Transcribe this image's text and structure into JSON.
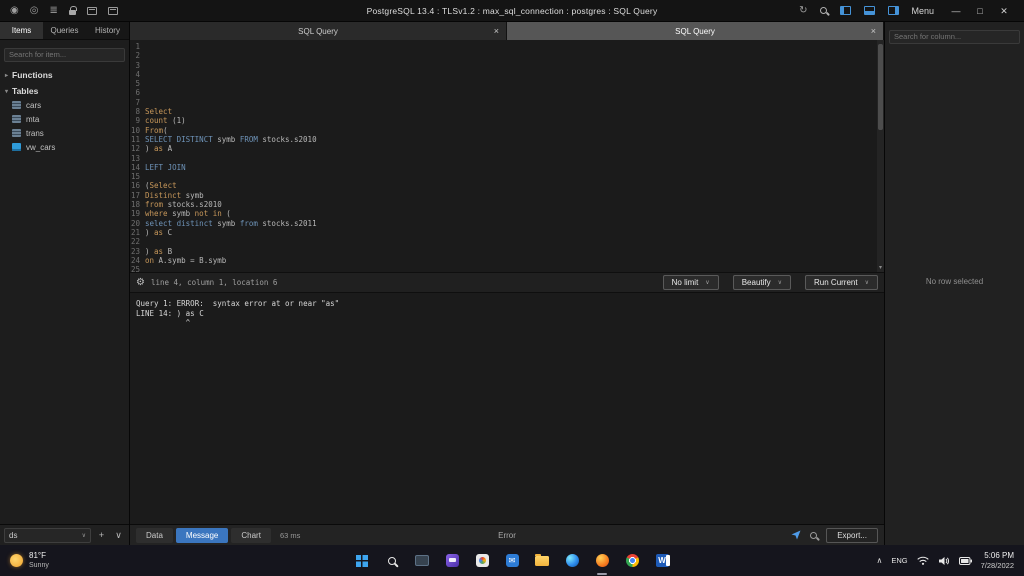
{
  "titlebar": {
    "title": "PostgreSQL 13.4 : TLSv1.2 : max_sql_connection : postgres : SQL Query",
    "menu_label": "Menu",
    "left_icons": [
      {
        "name": "app-logo-icon",
        "shape": "glyph",
        "glyph": "◉"
      },
      {
        "name": "eye-icon",
        "shape": "glyph",
        "glyph": "◎"
      },
      {
        "name": "list-icon",
        "shape": "glyph",
        "glyph": "≣"
      },
      {
        "name": "lock-icon",
        "shape": "lock",
        "glyph": ""
      },
      {
        "name": "console-icon",
        "shape": "panel",
        "glyph": ""
      },
      {
        "name": "editor-view-icon",
        "shape": "panel",
        "glyph": ""
      }
    ],
    "right_icons": [
      {
        "name": "refresh-icon",
        "shape": "glyph",
        "glyph": "↻"
      },
      {
        "name": "search-icon",
        "shape": "mag",
        "glyph": ""
      },
      {
        "name": "layout-left-icon",
        "shape": "layoutl",
        "glyph": ""
      },
      {
        "name": "layout-bottom-icon",
        "shape": "layoutb",
        "glyph": ""
      },
      {
        "name": "layout-right-icon",
        "shape": "layoutr",
        "glyph": ""
      }
    ],
    "window_controls": [
      {
        "name": "minimize-button",
        "glyph": "—"
      },
      {
        "name": "maximize-button",
        "glyph": "□"
      },
      {
        "name": "close-button",
        "glyph": "✕"
      }
    ]
  },
  "sidebar": {
    "tabs": [
      {
        "label": "Items",
        "active": true
      },
      {
        "label": "Queries",
        "active": false
      },
      {
        "label": "History",
        "active": false
      }
    ],
    "search_placeholder": "Search for item...",
    "sections": [
      {
        "label": "Functions",
        "chevron": "▸"
      },
      {
        "label": "Tables",
        "chevron": "▾"
      }
    ],
    "tables": [
      {
        "name": "cars",
        "type": "table"
      },
      {
        "name": "mta",
        "type": "table"
      },
      {
        "name": "trans",
        "type": "table"
      },
      {
        "name": "vw_cars",
        "type": "view"
      }
    ],
    "footer": {
      "database": "ds",
      "add_label": "+",
      "chevron": "∨"
    }
  },
  "query_tabs": [
    {
      "label": "SQL Query",
      "close": "×",
      "active": false
    },
    {
      "label": "SQL Query",
      "close": "×",
      "active": true
    }
  ],
  "editor": {
    "scroll_arrow": "▾",
    "lines": [
      {
        "n": 1,
        "tokens": []
      },
      {
        "n": 2,
        "tokens": []
      },
      {
        "n": 3,
        "tokens": []
      },
      {
        "n": 4,
        "tokens": []
      },
      {
        "n": 5,
        "tokens": []
      },
      {
        "n": 6,
        "tokens": []
      },
      {
        "n": 7,
        "tokens": []
      },
      {
        "n": 8,
        "tokens": [
          {
            "t": "Select",
            "c": "o"
          }
        ]
      },
      {
        "n": 9,
        "tokens": [
          {
            "t": "count ",
            "c": "o"
          },
          {
            "t": "(1)",
            "c": "p"
          }
        ]
      },
      {
        "n": 10,
        "tokens": [
          {
            "t": "From",
            "c": "o"
          },
          {
            "t": "(",
            "c": "p"
          }
        ]
      },
      {
        "n": 11,
        "tokens": [
          {
            "t": "SELECT DISTINCT",
            "c": "b"
          },
          {
            "t": " symb ",
            "c": "p"
          },
          {
            "t": "FROM",
            "c": "b"
          },
          {
            "t": " stocks.s2010",
            "c": "p"
          }
        ]
      },
      {
        "n": 12,
        "tokens": [
          {
            "t": ") ",
            "c": "p"
          },
          {
            "t": "as",
            "c": "o"
          },
          {
            "t": " A",
            "c": "p"
          }
        ]
      },
      {
        "n": 13,
        "tokens": []
      },
      {
        "n": 14,
        "tokens": [
          {
            "t": "LEFT JOIN",
            "c": "b"
          }
        ]
      },
      {
        "n": 15,
        "tokens": []
      },
      {
        "n": 16,
        "tokens": [
          {
            "t": "(",
            "c": "p"
          },
          {
            "t": "Select",
            "c": "o"
          }
        ]
      },
      {
        "n": 17,
        "tokens": [
          {
            "t": "Distinct",
            "c": "o"
          },
          {
            "t": " symb",
            "c": "p"
          }
        ]
      },
      {
        "n": 18,
        "tokens": [
          {
            "t": "from",
            "c": "o"
          },
          {
            "t": " stocks.s2010",
            "c": "p"
          }
        ]
      },
      {
        "n": 19,
        "tokens": [
          {
            "t": "where",
            "c": "o"
          },
          {
            "t": " symb ",
            "c": "p"
          },
          {
            "t": "not in",
            "c": "o"
          },
          {
            "t": " (",
            "c": "p"
          }
        ]
      },
      {
        "n": 20,
        "tokens": [
          {
            "t": "select distinct",
            "c": "b"
          },
          {
            "t": " symb ",
            "c": "p"
          },
          {
            "t": "from",
            "c": "b"
          },
          {
            "t": " stocks.s2011",
            "c": "p"
          }
        ]
      },
      {
        "n": 21,
        "tokens": [
          {
            "t": ") ",
            "c": "p"
          },
          {
            "t": "as",
            "c": "o"
          },
          {
            "t": " C",
            "c": "p"
          }
        ]
      },
      {
        "n": 22,
        "tokens": []
      },
      {
        "n": 23,
        "tokens": [
          {
            "t": ") ",
            "c": "p"
          },
          {
            "t": "as",
            "c": "o"
          },
          {
            "t": " B",
            "c": "p"
          }
        ]
      },
      {
        "n": 24,
        "tokens": [
          {
            "t": "on",
            "c": "o"
          },
          {
            "t": " A.symb ",
            "c": "p"
          },
          {
            "t": "= B.symb",
            "c": "p"
          }
        ]
      },
      {
        "n": 25,
        "tokens": []
      }
    ]
  },
  "toolbar": {
    "gear": "⚙",
    "position": "line 4, column 1, location 6",
    "limit_button": "No limit",
    "beautify_button": "Beautify",
    "run_button": "Run Current",
    "chevron": "∨"
  },
  "results": {
    "lines": [
      "Query 1: ERROR:  syntax error at or near \"as\"",
      "LINE 14: ) as C",
      "           ^"
    ]
  },
  "footer": {
    "tabs": [
      {
        "label": "Data",
        "active": false
      },
      {
        "label": "Message",
        "active": true
      },
      {
        "label": "Chart",
        "active": false
      }
    ],
    "elapsed": "63 ms",
    "status": "Error",
    "export_label": "Export..."
  },
  "right_panel": {
    "search_placeholder": "Search for column...",
    "empty_message": "No row selected"
  },
  "taskbar": {
    "weather": {
      "temp": "81°F",
      "condition": "Sunny"
    },
    "apps": [
      {
        "name": "windows-start-icon",
        "shape": "winlogo",
        "active": false
      },
      {
        "name": "taskbar-search-icon",
        "shape": "tbmag",
        "active": false
      },
      {
        "name": "terminal-app-icon",
        "shape": "screen",
        "active": false
      },
      {
        "name": "chat-app-icon",
        "shape": "chat",
        "active": false
      },
      {
        "name": "photos-app-icon",
        "shape": "photos",
        "active": false
      },
      {
        "name": "mail-app-icon",
        "shape": "mail",
        "active": false
      },
      {
        "name": "file-explorer-icon",
        "shape": "folder",
        "active": false
      },
      {
        "name": "edge-browser-icon",
        "shape": "edge",
        "active": false
      },
      {
        "name": "sql-client-app-icon",
        "shape": "orange",
        "active": true
      },
      {
        "name": "chrome-browser-icon",
        "shape": "chrome",
        "active": false
      },
      {
        "name": "word-app-icon",
        "shape": "word",
        "active": false
      }
    ],
    "tray": {
      "chevron": "∧",
      "language": "ENG",
      "time": "5:06 PM",
      "date": "7/28/2022"
    }
  },
  "colors": {
    "accent_blue": "#3b76bf",
    "keyword_orange": "#c7975a",
    "keyword_blue": "#6e93b8",
    "view_icon_blue": "#2f9bd8"
  }
}
